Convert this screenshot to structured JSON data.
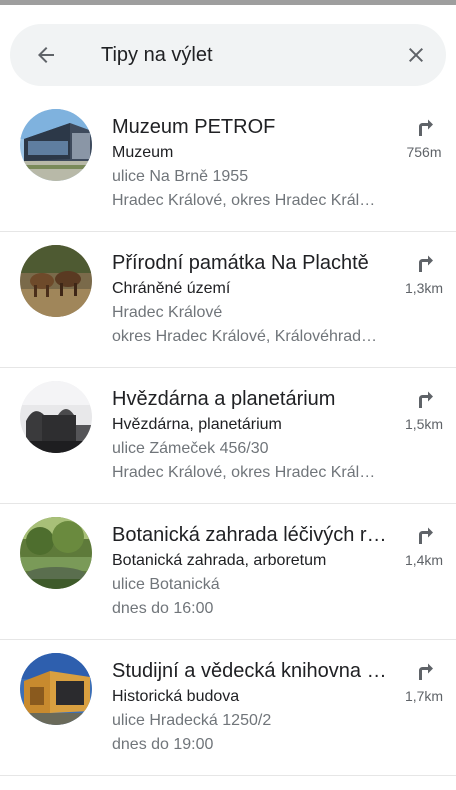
{
  "search": {
    "query": "Tipy na výlet"
  },
  "icons": {
    "back": "arrow-left-icon",
    "clear": "close-icon",
    "directions": "turn-right-arrow-icon"
  },
  "colors": {
    "icon": "#5f6368",
    "secondary_text": "#70757a",
    "divider": "#e6e6e6",
    "search_bg": "#f1f3f4"
  },
  "results": [
    {
      "title": "Muzeum PETROF",
      "category": "Muzeum",
      "line1": "ulice Na Brně 1955",
      "line2": "Hradec Králové, okres Hradec Král…",
      "distance": "756m"
    },
    {
      "title": "Přírodní památka Na Plachtě",
      "category": "Chráněné území",
      "line1": "Hradec Králové",
      "line2": "okres Hradec Králové, Královéhrad…",
      "distance": "1,3km"
    },
    {
      "title": "Hvězdárna a planetárium",
      "category": "Hvězdárna, planetárium",
      "line1": "ulice Zámeček 456/30",
      "line2": "Hradec Králové, okres Hradec Král…",
      "distance": "1,5km"
    },
    {
      "title": "Botanická zahrada léčivých ro…",
      "category": "Botanická zahrada, arboretum",
      "line1": "ulice Botanická",
      "line2": "dnes do 16:00",
      "distance": "1,4km"
    },
    {
      "title": "Studijní a vědecká knihovna H…",
      "category": "Historická budova",
      "line1": "ulice Hradecká 1250/2",
      "line2": "dnes do 19:00",
      "distance": "1,7km"
    }
  ]
}
